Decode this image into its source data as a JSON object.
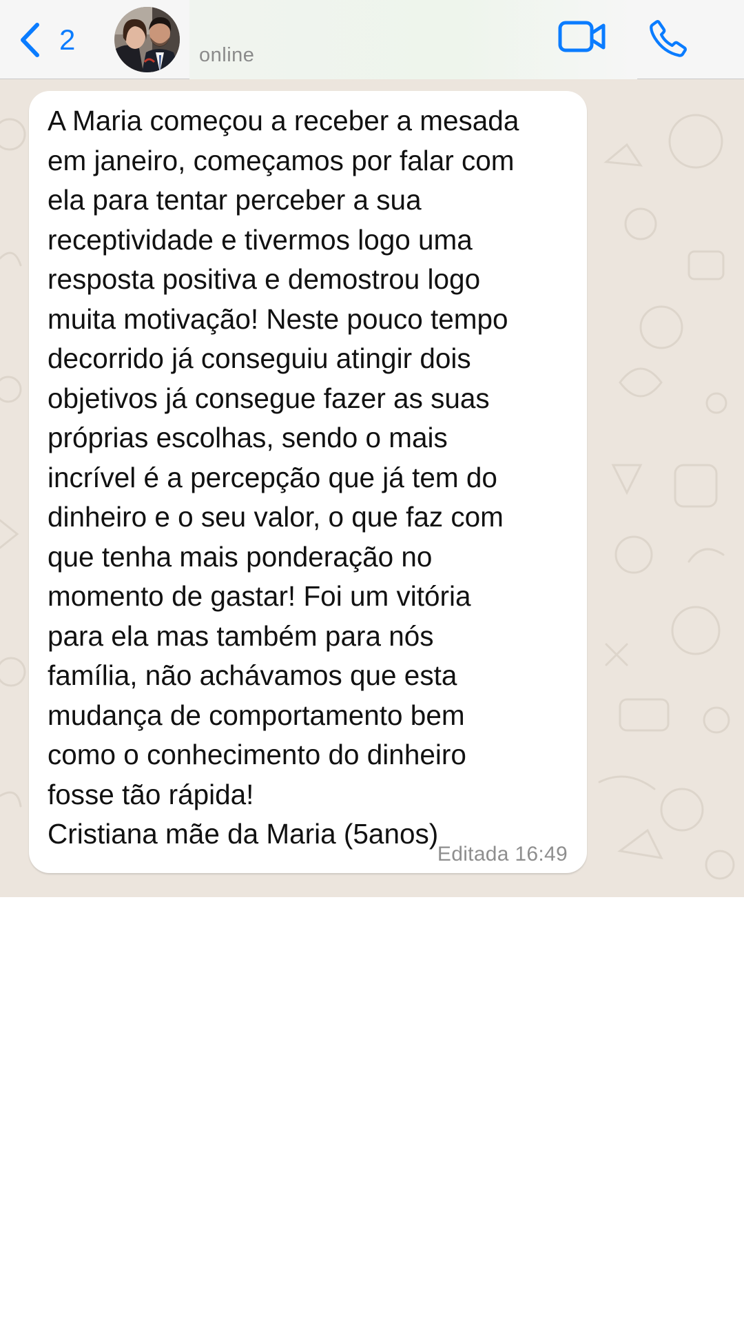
{
  "header": {
    "back_count": "2",
    "status": "online",
    "icons": {
      "back": "chevron-left-icon",
      "video": "video-camera-icon",
      "call": "phone-icon"
    },
    "accent_color": "#0a7cff"
  },
  "chat": {
    "wallpaper_color": "#ece5dd",
    "messages": [
      {
        "text": "A Maria começou a receber a mesada\nem janeiro, começamos por falar com\nela para tentar perceber a sua\nreceptividade e tivermos logo uma\nresposta positiva e demostrou logo\nmuita motivação! Neste pouco tempo\ndecorrido já conseguiu atingir dois\nobjetivos já consegue fazer as suas\npróprias escolhas, sendo o mais\nincrível é a percepção que já tem do\ndinheiro e o seu valor, o que faz com\nque tenha mais ponderação no\nmomento de gastar! Foi um vitória\npara ela mas também para nós\nfamília, não achávamos que esta\nmudança de comportamento bem\ncomo o conhecimento do dinheiro\nfosse tão rápida!\nCristiana mãe da Maria (5anos)",
        "edited_label": "Editada",
        "time": "16:49"
      }
    ]
  }
}
